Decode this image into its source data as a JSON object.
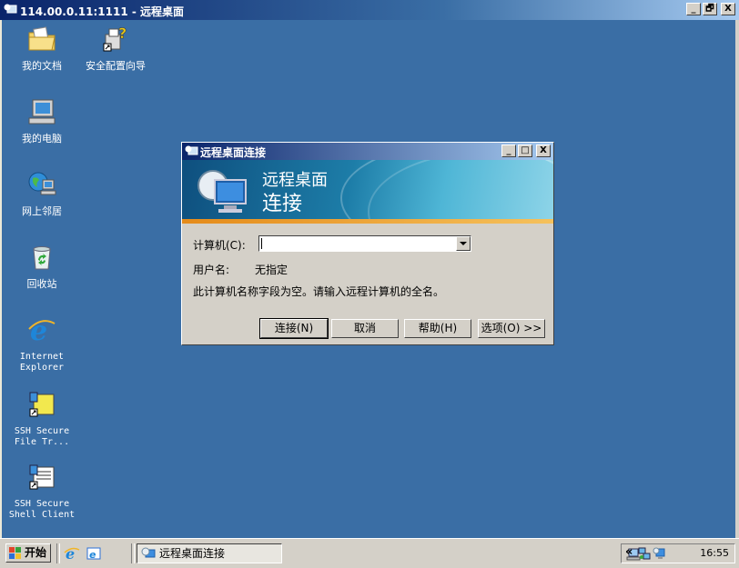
{
  "outer_window": {
    "title": "114.00.0.11:1111 - 远程桌面",
    "buttons": [
      "_",
      "🗗",
      "X"
    ]
  },
  "desktop_icons": [
    {
      "name": "my-documents",
      "label": "我的文档",
      "icon": "folder-documents-icon"
    },
    {
      "name": "security-wizard",
      "label": "安全配置向导",
      "icon": "security-wizard-icon"
    },
    {
      "name": "my-computer",
      "label": "我的电脑",
      "icon": "computer-icon"
    },
    {
      "name": "network-places",
      "label": "网上邻居",
      "icon": "network-globe-icon"
    },
    {
      "name": "recycle-bin",
      "label": "回收站",
      "icon": "recycle-bin-icon"
    },
    {
      "name": "internet-explorer",
      "label": "Internet Explorer",
      "icon": "ie-icon"
    },
    {
      "name": "ssh-file-transfer",
      "label": "SSH Secure File Tr...",
      "icon": "ssh-file-transfer-icon"
    },
    {
      "name": "ssh-shell-client",
      "label": "SSH Secure Shell Client",
      "icon": "ssh-shell-icon"
    }
  ],
  "dialog": {
    "title": "远程桌面连接",
    "banner_line1": "远程桌面",
    "banner_line2": "连接",
    "computer_label": "计算机(C):",
    "computer_value": "",
    "username_label": "用户名:",
    "username_value": "无指定",
    "message": "此计算机名称字段为空。请输入远程计算机的全名。",
    "buttons": {
      "connect": "连接(N)",
      "cancel": "取消",
      "help": "帮助(H)",
      "options": "选项(O) >>"
    }
  },
  "taskbar": {
    "start_label": "开始",
    "task_item": "远程桌面连接",
    "tray_chevron": "«",
    "clock": "16:55"
  }
}
